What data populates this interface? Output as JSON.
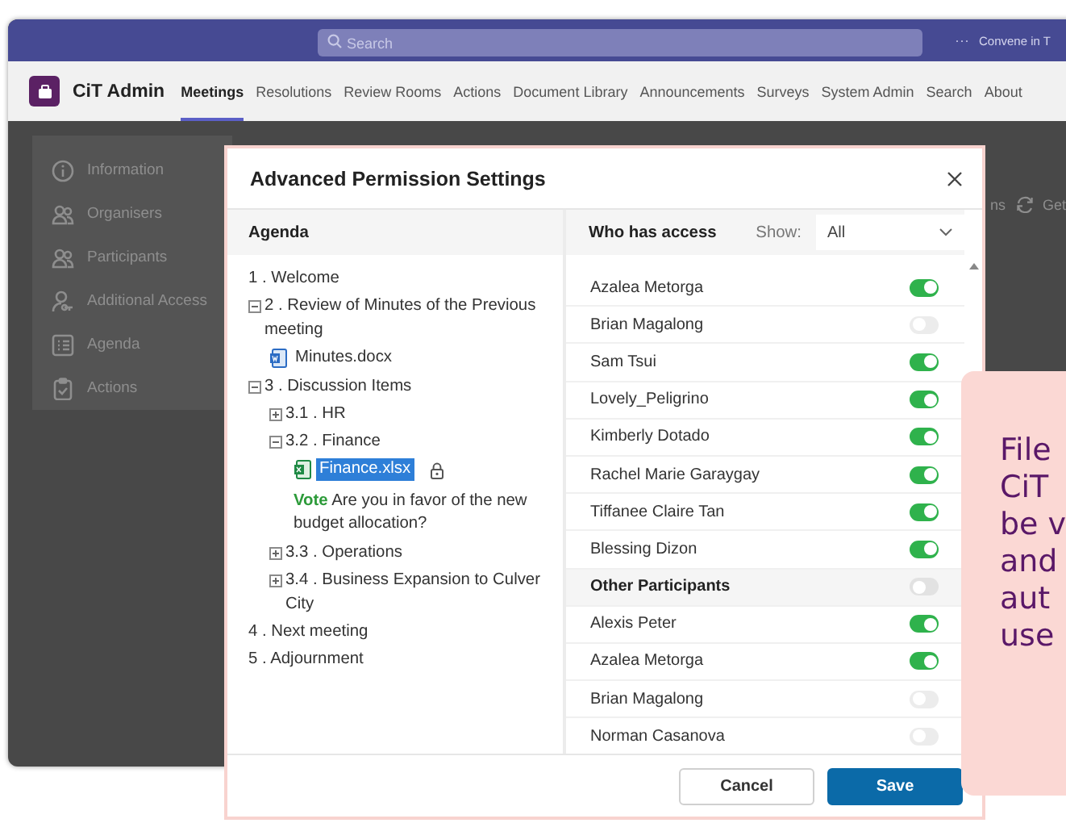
{
  "top_bar": {
    "search_placeholder": "Search",
    "more": "···",
    "account": "Convene in T"
  },
  "app": {
    "name": "CiT Admin",
    "tabs": [
      {
        "label": "Meetings",
        "selected": true
      },
      {
        "label": "Resolutions",
        "selected": false
      },
      {
        "label": "Review Rooms",
        "selected": false
      },
      {
        "label": "Actions",
        "selected": false
      },
      {
        "label": "Document Library",
        "selected": false
      },
      {
        "label": "Announcements",
        "selected": false
      },
      {
        "label": "Surveys",
        "selected": false
      },
      {
        "label": "System Admin",
        "selected": false
      },
      {
        "label": "Search",
        "selected": false
      },
      {
        "label": "About",
        "selected": false
      }
    ]
  },
  "sidebar": {
    "items": [
      {
        "label": "Information",
        "kind": "info"
      },
      {
        "label": "Organisers",
        "kind": "people"
      },
      {
        "label": "Participants",
        "kind": "people"
      },
      {
        "label": "Additional Access",
        "kind": "person-key"
      },
      {
        "label": "Agenda",
        "kind": "list"
      },
      {
        "label": "Actions",
        "kind": "clipboard"
      }
    ]
  },
  "behind_dialog": {
    "fragment": "ns",
    "get_label": "Get"
  },
  "dialog": {
    "title": "Advanced Permission Settings",
    "agenda_header": "Agenda",
    "access_header": "Who has access",
    "show_label": "Show:",
    "show_value": "All",
    "agenda": [
      {
        "kind": "topic",
        "label": "1 . Welcome"
      },
      {
        "kind": "topic",
        "label": "2 . Review of Minutes of the Previous meeting",
        "expanded": true,
        "children": [
          {
            "kind": "word-file",
            "label": "Minutes.docx",
            "selected": false
          }
        ]
      },
      {
        "kind": "topic",
        "label": "3 . Discussion Items",
        "expanded": true,
        "children": [
          {
            "kind": "topic",
            "label": "3.1 . HR",
            "expanded": false
          },
          {
            "kind": "topic",
            "label": "3.2 . Finance",
            "expanded": true,
            "children": [
              {
                "kind": "excel-file",
                "label": "Finance.xlsx",
                "selected": true,
                "locked": true
              },
              {
                "kind": "vote",
                "label": "**Vote** Are you in favor of the new budget allocation?"
              }
            ]
          },
          {
            "kind": "topic",
            "label": "3.3 . Operations",
            "expanded": false
          },
          {
            "kind": "topic",
            "label": "3.4 . Business Expansion to Culver City",
            "expanded": false
          }
        ]
      },
      {
        "kind": "topic",
        "label": "4 . Next meeting"
      },
      {
        "kind": "topic",
        "label": "5 . Adjournment"
      }
    ],
    "access": [
      {
        "kind": "person",
        "name": "Azalea Metorga",
        "on": true
      },
      {
        "kind": "person",
        "name": "Brian Magalong",
        "on": false
      },
      {
        "kind": "person",
        "name": "Sam Tsui",
        "on": true
      },
      {
        "kind": "person",
        "name": "Lovely_Peligrino",
        "on": true
      },
      {
        "kind": "person",
        "name": "Kimberly Dotado",
        "on": true
      },
      {
        "kind": "person",
        "name": "Rachel Marie Garaygay",
        "on": true
      },
      {
        "kind": "person",
        "name": "Tiffanee Claire Tan",
        "on": true
      },
      {
        "kind": "person",
        "name": "Blessing Dizon",
        "on": true
      },
      {
        "kind": "group",
        "name": "Other Participants",
        "on": false
      },
      {
        "kind": "person",
        "name": "Alexis Peter",
        "on": true
      },
      {
        "kind": "person",
        "name": "Azalea Metorga",
        "on": true
      },
      {
        "kind": "person",
        "name": "Brian Magalong",
        "on": false
      },
      {
        "kind": "person",
        "name": "Norman Casanova",
        "on": false
      }
    ],
    "buttons": [
      {
        "label": "Cancel",
        "kind": "secondary"
      },
      {
        "label": "Save",
        "kind": "primary"
      }
    ]
  },
  "callout": {
    "lines": [
      "File",
      "CiT",
      "be v",
      "and",
      "aut",
      "use"
    ]
  }
}
